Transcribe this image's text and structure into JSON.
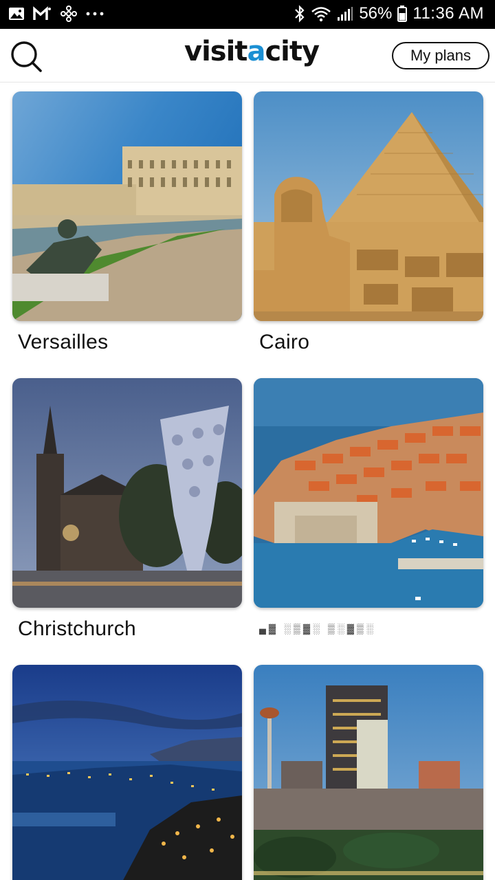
{
  "status_bar": {
    "left_icons": [
      "image-icon",
      "gmail-icon",
      "pinwheel-icon",
      "more-dots-icon"
    ],
    "battery": "56%",
    "time": "11:36 AM"
  },
  "header": {
    "logo": {
      "part1": "visit",
      "accent": "a",
      "part2": "city"
    },
    "my_plans_label": "My plans",
    "accent_color": "#1b8fd3"
  },
  "cities": [
    {
      "name": "Versailles"
    },
    {
      "name": "Cairo"
    },
    {
      "name": "Christchurch"
    },
    {
      "name": "▄▓ ░▒▓░ ▒░▓▒░"
    },
    {
      "name": ""
    },
    {
      "name": ""
    }
  ]
}
